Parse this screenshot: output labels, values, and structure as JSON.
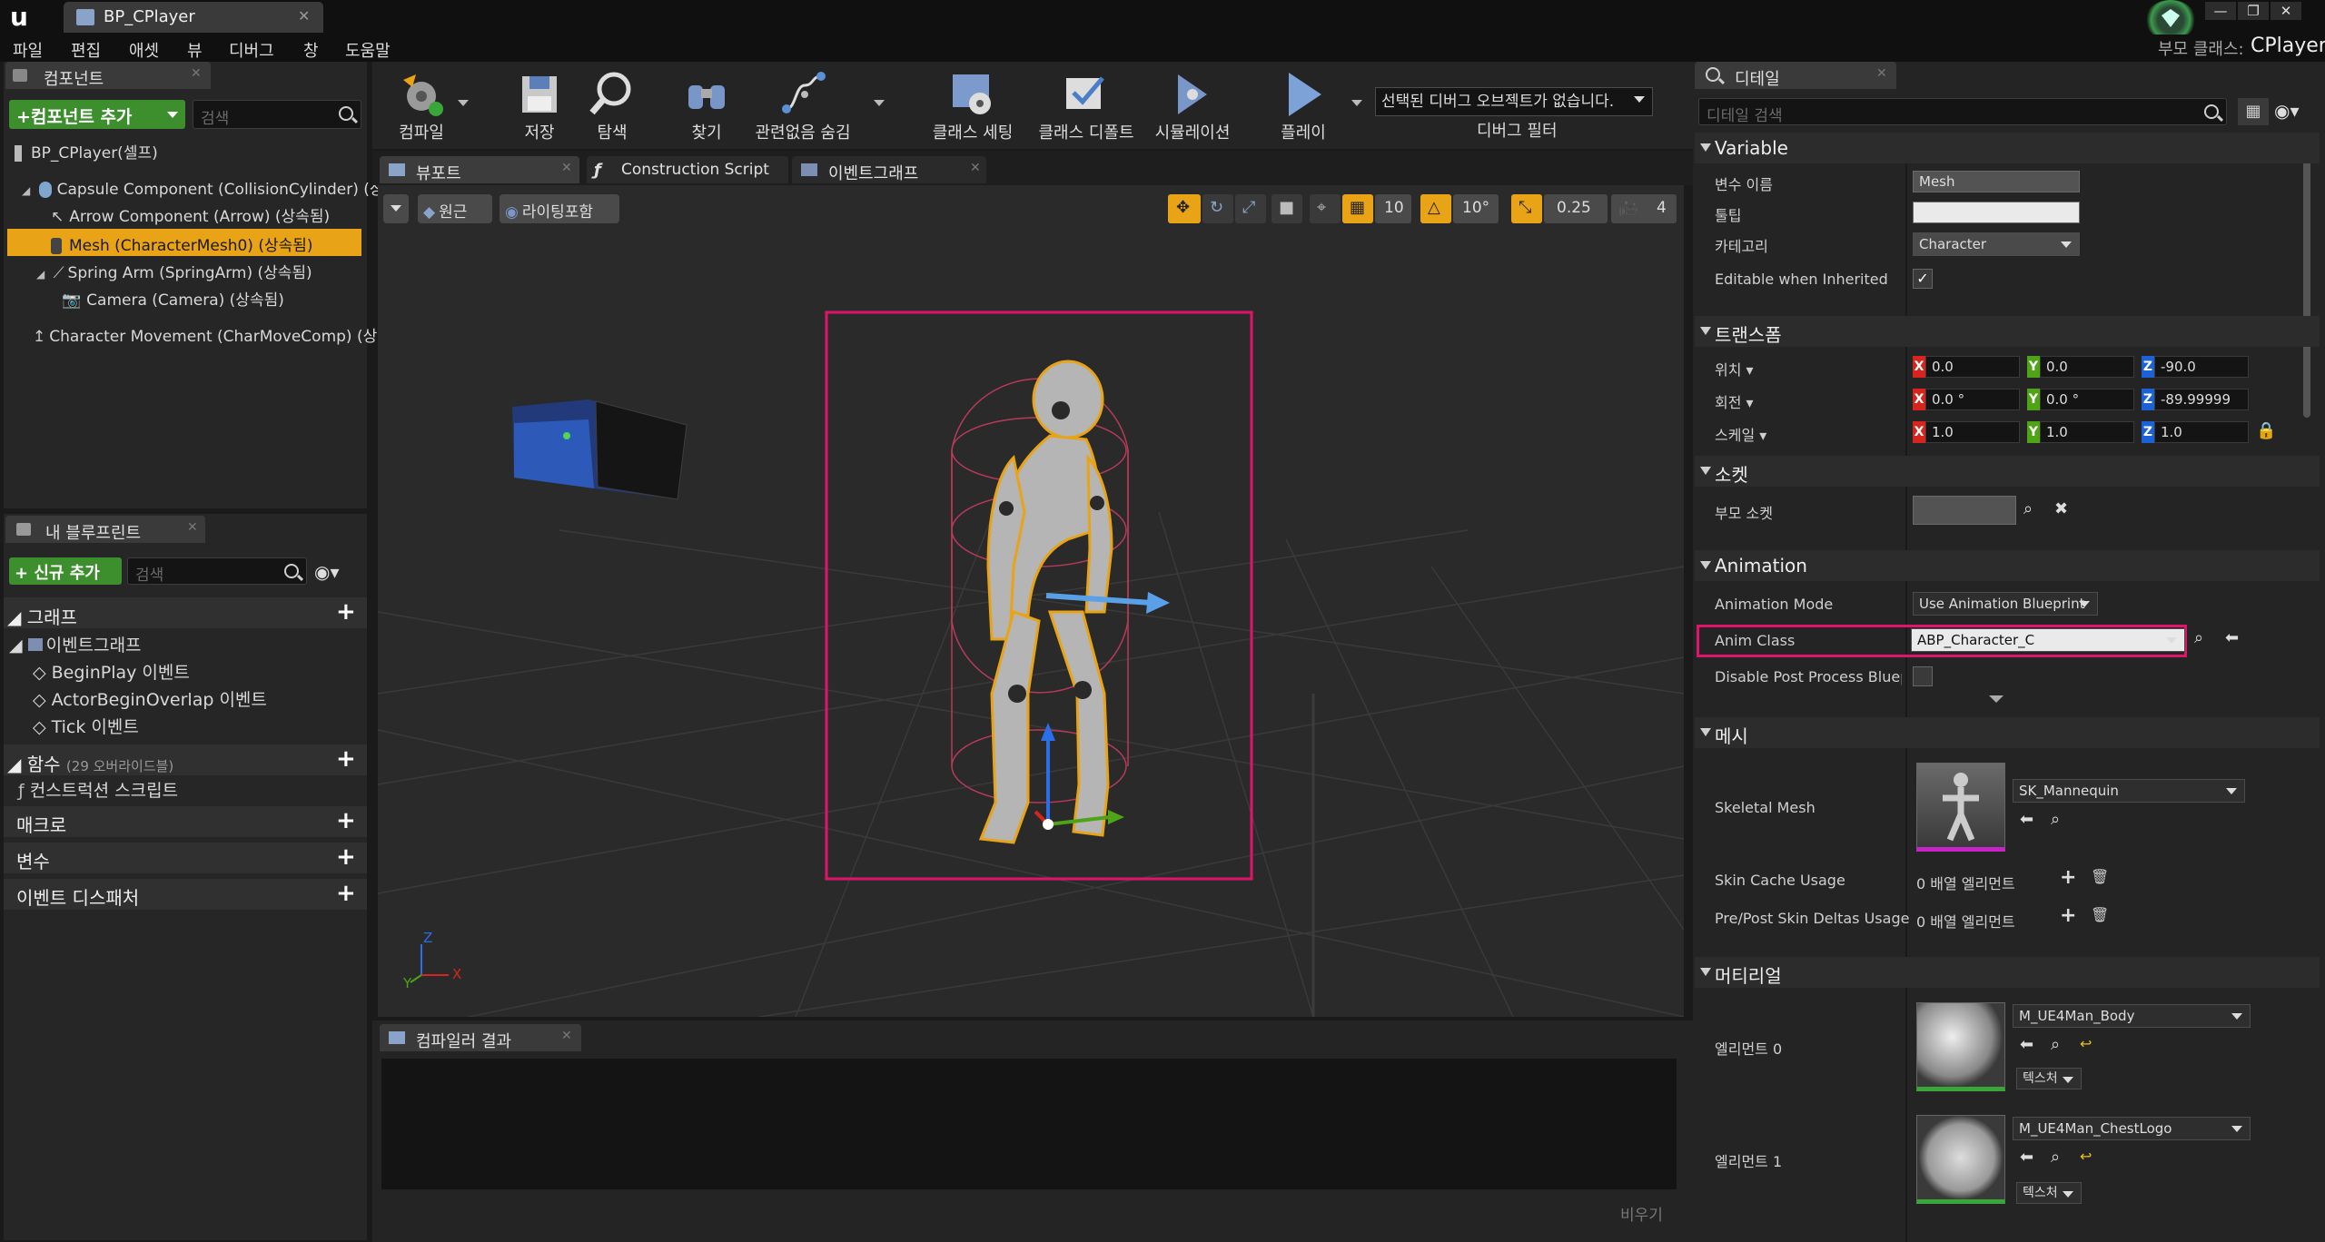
{
  "app": {
    "document_tab": "BP_CPlayer",
    "parent_class_label": "부모 클래스:",
    "parent_class_value": "CPlayer"
  },
  "menu": [
    "파일",
    "편집",
    "애셋",
    "뷰",
    "디버그",
    "창",
    "도움말"
  ],
  "components_panel": {
    "tab_label": "컴포넌트",
    "add_button": "+컴포넌트 추가",
    "search_placeholder": "검색",
    "root": "BP_CPlayer(셀프)",
    "items": [
      "Capsule Component (CollisionCylinder) (상",
      "Arrow Component (Arrow) (상속됨)",
      "Mesh (CharacterMesh0) (상속됨)",
      "Spring Arm (SpringArm) (상속됨)",
      "Camera (Camera) (상속됨)",
      "Character Movement (CharMoveComp) (상"
    ]
  },
  "my_blueprint": {
    "tab_label": "내 블루프린트",
    "new_button": "+ 신규 추가",
    "search_placeholder": "검색",
    "graphs_label": "그래프",
    "event_graph": "이벤트그래프",
    "events": [
      "BeginPlay 이벤트",
      "ActorBeginOverlap 이벤트",
      "Tick 이벤트"
    ],
    "functions_label": "함수",
    "functions_override": "(29 오버라이드블)",
    "construction_script": "컨스트럭션 스크립트",
    "macros_label": "매크로",
    "variables_label": "변수",
    "dispatchers_label": "이벤트 디스패처"
  },
  "toolbar": {
    "compile": "컴파일",
    "save": "저장",
    "browse": "탐색",
    "find": "찾기",
    "hide_unrelated": "관련없음 숨김",
    "class_settings": "클래스 세팅",
    "class_defaults": "클래스 디폴트",
    "simulation": "시뮬레이션",
    "play": "플레이",
    "debug_object": "선택된 디버그 오브젝트가 없습니다.",
    "debug_filter": "디버그 필터"
  },
  "editor_tabs": {
    "viewport": "뷰포트",
    "construction_script": "Construction Script",
    "event_graph": "이벤트그래프"
  },
  "viewport": {
    "perspective": "원근",
    "lit": "라이팅포함",
    "grid_snap": "10",
    "rot_snap": "10°",
    "scale_snap": "0.25",
    "cam_speed": "4",
    "axis_z": "Z",
    "axis_x": "X",
    "axis_y": "Y"
  },
  "compiler": {
    "tab_label": "컴파일러 결과",
    "clear": "비우기"
  },
  "details": {
    "tab_label": "디테일",
    "search_placeholder": "디테일 검색",
    "variable_section": "Variable",
    "var_name_label": "변수 이름",
    "var_name_value": "Mesh",
    "tooltip_label": "툴팁",
    "tooltip_value": "",
    "category_label": "카테고리",
    "category_value": "Character",
    "editable_label": "Editable when Inherited",
    "editable_checked": true,
    "transform_section": "트랜스폼",
    "location_label": "위치",
    "rotation_label": "회전",
    "scale_label": "스케일",
    "location": [
      "0.0",
      "0.0",
      "-90.0"
    ],
    "rotation": [
      "0.0 °",
      "0.0 °",
      "-89.99999"
    ],
    "scale": [
      "1.0",
      "1.0",
      "1.0"
    ],
    "socket_section": "소켓",
    "parent_socket_label": "부모 소켓",
    "animation_section": "Animation",
    "anim_mode_label": "Animation Mode",
    "anim_mode_value": "Use Animation Blueprint",
    "anim_class_label": "Anim Class",
    "anim_class_value": "ABP_Character_C",
    "disable_pp_label": "Disable Post Process Blueprint",
    "mesh_section": "메시",
    "skeletal_mesh_label": "Skeletal Mesh",
    "skeletal_mesh_value": "SK_Mannequin",
    "skin_cache_label": "Skin Cache Usage",
    "skin_cache_value": "0 배열 엘리먼트",
    "prepost_label": "Pre/Post Skin Deltas Usage",
    "prepost_value": "0 배열 엘리먼트",
    "material_section": "머티리얼",
    "element0_label": "엘리먼트 0",
    "element0_value": "M_UE4Man_Body",
    "element1_label": "엘리먼트 1",
    "element1_value": "M_UE4Man_ChestLogo",
    "texture_btn": "텍스처"
  },
  "colors": {
    "accent_orange": "#e8a317",
    "selection_magenta": "#e0156a",
    "add_green": "#3c8f2c"
  }
}
